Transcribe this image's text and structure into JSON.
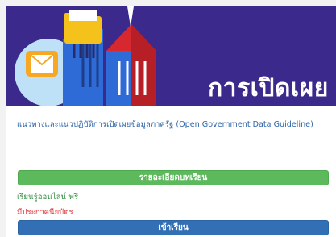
{
  "banner": {
    "title": "การเปิดเผย",
    "colors": {
      "background": "#3b2a8c",
      "folder": "#f5c21b",
      "shield": "#2f6bd6",
      "tower_red": "#d8282f",
      "tower_blue": "#3a73d0"
    },
    "icons": [
      "envelope-icon",
      "folder-icon",
      "shield-icon",
      "tower-icon"
    ]
  },
  "course": {
    "title": "แนวทางและแนวปฏิบัติการเปิดเผยข้อมูลภาครัฐ (Open Government Data Guideline)",
    "details_button": "รายละเอียดบทเรียน",
    "free_label": "เรียนรู้ออนไลน์ ฟรี",
    "certificate_label": "มีประกาศนียบัตร",
    "enroll_button": "เข้าเรียน"
  },
  "colors": {
    "details_button": "#5cb95c",
    "enroll_button": "#336fb5",
    "title_text": "#2c63a8",
    "free_text": "#2c8a3c",
    "certificate_text": "#e0333a"
  }
}
